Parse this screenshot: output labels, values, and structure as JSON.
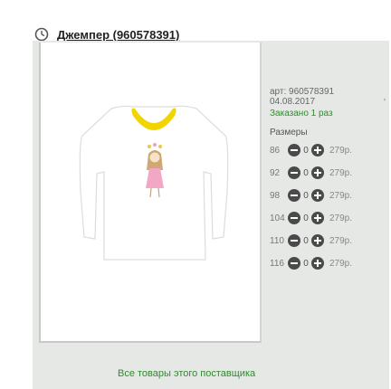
{
  "header": {
    "title": "Джемпер (960578391)",
    "icon": "clock-icon"
  },
  "product": {
    "article": "арт: 960578391",
    "date": "04.08.2017",
    "ordered": "Заказано 1 раз",
    "sizes_title": "Размеры",
    "sizes": [
      {
        "size": "86",
        "qty": "0",
        "price": "279р."
      },
      {
        "size": "92",
        "qty": "0",
        "price": "279р."
      },
      {
        "size": "98",
        "qty": "0",
        "price": "279р."
      },
      {
        "size": "104",
        "qty": "0",
        "price": "279р."
      },
      {
        "size": "110",
        "qty": "0",
        "price": "279р."
      },
      {
        "size": "116",
        "qty": "0",
        "price": "279р."
      }
    ]
  },
  "mark": "'",
  "footer": {
    "link": "Все товары этого поставщика"
  },
  "colors": {
    "panel_bg": "#e5e8e5",
    "link_green": "#2e8b2e",
    "collar_yellow": "#f2d400"
  }
}
